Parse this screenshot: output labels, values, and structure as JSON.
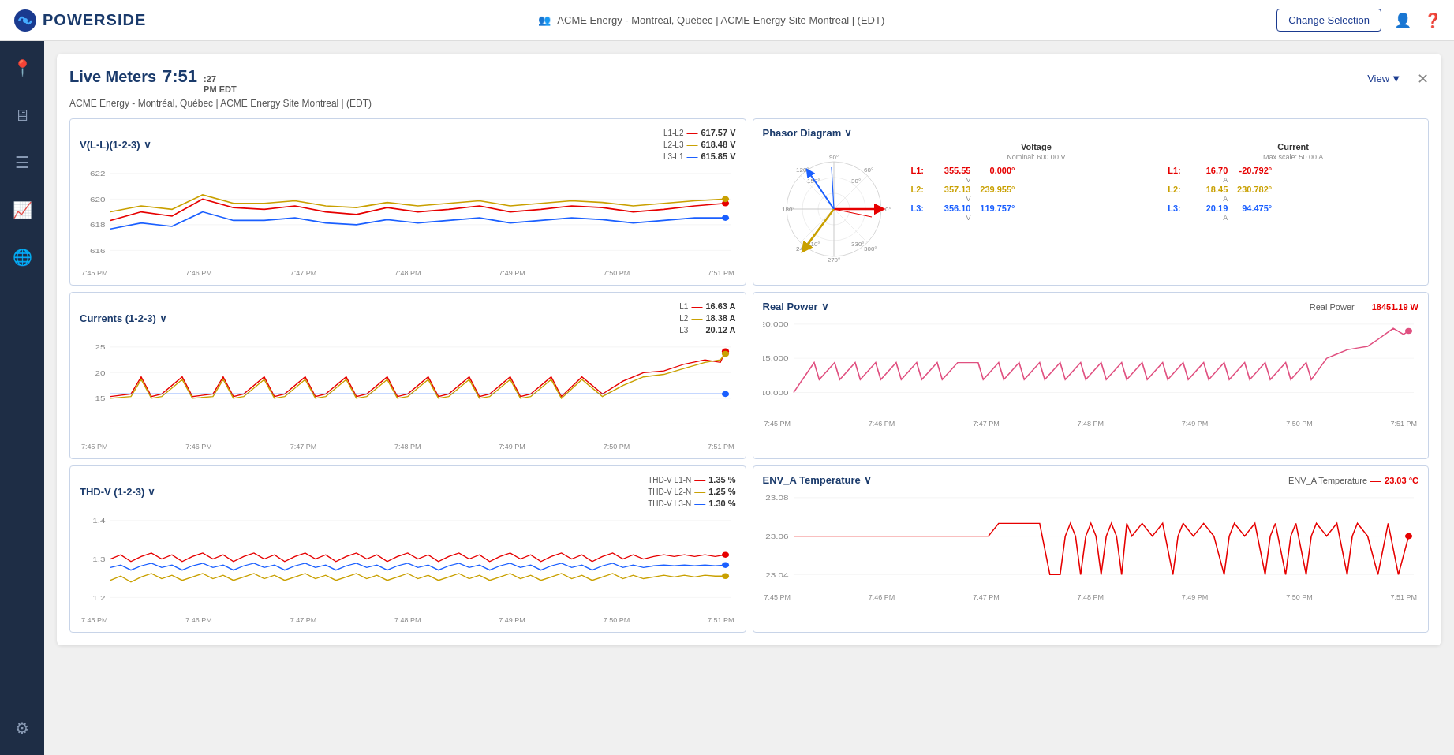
{
  "navbar": {
    "logo_text": "POWERSIDE",
    "site_info": "ACME Energy - Montréal, Québec | ACME Energy Site Montreal | (EDT)",
    "change_selection": "Change Selection"
  },
  "live_meters": {
    "title": "Live Meters",
    "time": "7:51",
    "time_sub1": ":27",
    "time_sub2": "PM EDT",
    "view_label": "View",
    "breadcrumb": "ACME Energy - Montréal, Québec | ACME Energy Site Montreal | (EDT)"
  },
  "charts": {
    "voltage": {
      "title": "V(L-L)(1-2-3)",
      "legend": [
        {
          "label": "L1-L2",
          "value": "617.57 V",
          "color": "red"
        },
        {
          "label": "L2-L3",
          "value": "618.48 V",
          "color": "gold"
        },
        {
          "label": "L3-L1",
          "value": "615.85 V",
          "color": "blue"
        }
      ],
      "y_labels": [
        "622",
        "620",
        "618",
        "616"
      ],
      "x_labels": [
        "7:45 PM",
        "7:46 PM",
        "7:47 PM",
        "7:48 PM",
        "7:49 PM",
        "7:50 PM",
        "7:51 PM"
      ]
    },
    "phasor": {
      "title": "Phasor Diagram",
      "voltage_nominal": "Nominal: 600.00 V",
      "current_max": "Max scale: 50.00 A",
      "rows_voltage": [
        {
          "label": "L1:",
          "val1": "355.55",
          "val2": "0.000°",
          "unit": "V"
        },
        {
          "label": "L2:",
          "val1": "357.13",
          "val2": "239.955°",
          "unit": "V"
        },
        {
          "label": "L3:",
          "val1": "356.10",
          "val2": "119.757°",
          "unit": "V"
        }
      ],
      "rows_current": [
        {
          "label": "L1:",
          "val1": "16.70",
          "val2": "-20.792°",
          "unit": "A"
        },
        {
          "label": "L2:",
          "val1": "18.45",
          "val2": "230.782°",
          "unit": "A"
        },
        {
          "label": "L3:",
          "val1": "20.19",
          "val2": "94.475°",
          "unit": "A"
        }
      ]
    },
    "currents": {
      "title": "Currents (1-2-3)",
      "legend": [
        {
          "label": "L1",
          "value": "16.63 A",
          "color": "red"
        },
        {
          "label": "L2",
          "value": "18.38 A",
          "color": "gold"
        },
        {
          "label": "L3",
          "value": "20.12 A",
          "color": "blue"
        }
      ],
      "y_labels": [
        "25",
        "20",
        "15"
      ],
      "x_labels": [
        "7:45 PM",
        "7:46 PM",
        "7:47 PM",
        "7:48 PM",
        "7:49 PM",
        "7:50 PM",
        "7:51 PM"
      ]
    },
    "real_power": {
      "title": "Real Power",
      "legend_label": "Real Power",
      "legend_value": "18451.19 W",
      "y_labels": [
        "20,000",
        "15,000",
        "10,000"
      ],
      "x_labels": [
        "7:45 PM",
        "7:46 PM",
        "7:47 PM",
        "7:48 PM",
        "7:49 PM",
        "7:50 PM",
        "7:51 PM"
      ]
    },
    "thd_v": {
      "title": "THD-V (1-2-3)",
      "legend": [
        {
          "label": "THD-V L1-N",
          "value": "1.35 %",
          "color": "red"
        },
        {
          "label": "THD-V L2-N",
          "value": "1.25 %",
          "color": "gold"
        },
        {
          "label": "THD-V L3-N",
          "value": "1.30 %",
          "color": "blue"
        }
      ],
      "y_labels": [
        "1.4",
        "1.3",
        "1.2"
      ],
      "x_labels": [
        "7:45 PM",
        "7:46 PM",
        "7:47 PM",
        "7:48 PM",
        "7:49 PM",
        "7:50 PM",
        "7:51 PM"
      ]
    },
    "env_temp": {
      "title": "ENV_A Temperature",
      "legend_label": "ENV_A Temperature",
      "legend_value": "23.03 °C",
      "y_labels": [
        "23.08",
        "23.06",
        "23.04"
      ],
      "x_labels": [
        "7:45 PM",
        "7:46 PM",
        "7:47 PM",
        "7:48 PM",
        "7:49 PM",
        "7:50 PM",
        "7:51 PM"
      ]
    }
  },
  "sidebar_icons": [
    "location",
    "monitor",
    "list",
    "chart",
    "globe",
    "settings"
  ]
}
